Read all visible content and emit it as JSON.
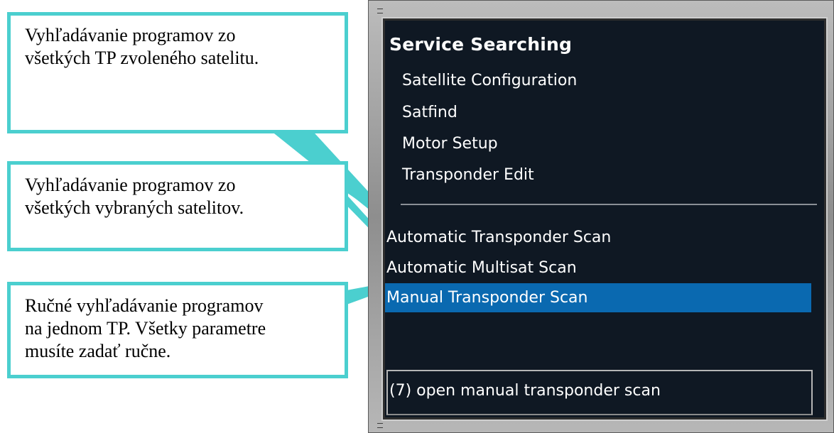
{
  "callouts": [
    {
      "text": "Vyhľadávanie programov zo\nvšetkých TP zvoleného satelitu."
    },
    {
      "text": "Vyhľadávanie programov zo\nvšetkých vybraných satelitov."
    },
    {
      "text": "Ručné vyhľadávanie programov\nna jednom TP. Všetky parametre\nmusíte zadať ručne."
    }
  ],
  "menu": {
    "title": "Service Searching",
    "items": [
      {
        "label": "Satellite Configuration"
      },
      {
        "label": "Satfind"
      },
      {
        "label": "Motor Setup"
      },
      {
        "label": "Transponder Edit"
      },
      {
        "label": "Automatic Transponder Scan"
      },
      {
        "label": "Automatic Multisat Scan"
      },
      {
        "label": "Manual Transponder Scan",
        "selected": true
      }
    ],
    "status": "(7) open manual transponder scan"
  },
  "colors": {
    "callout_border": "#4bcfcf",
    "panel_bg": "#0f1823",
    "selection": "#0a69b0",
    "text": "#ffffff"
  }
}
